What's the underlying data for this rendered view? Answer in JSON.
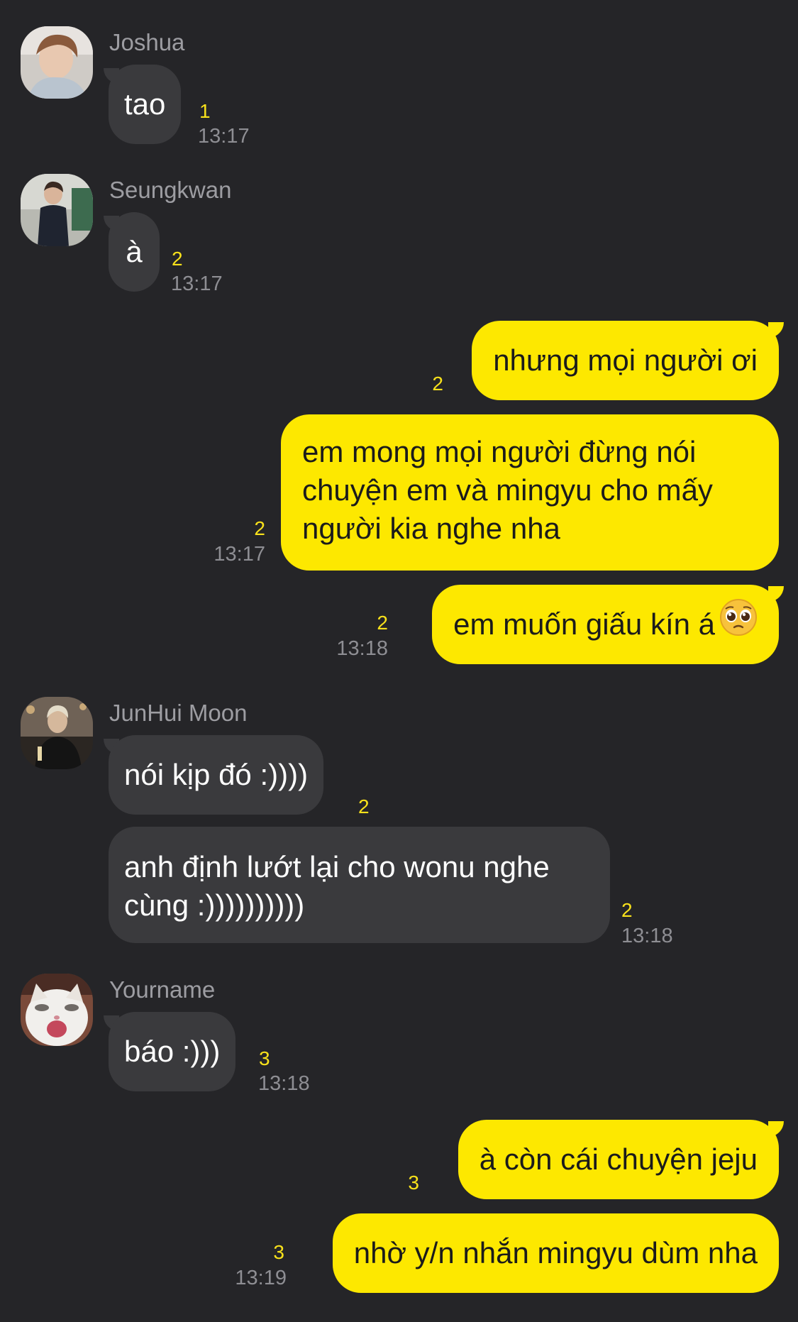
{
  "messages": [
    {
      "sender": "Joshua",
      "text": "tao",
      "unread": "1",
      "time": "13:17"
    },
    {
      "sender": "Seungkwan",
      "text": "à",
      "unread": "2",
      "time": "13:17"
    },
    {
      "sender": "me",
      "text": "nhưng mọi người ơi",
      "unread": "2"
    },
    {
      "sender": "me",
      "lines": [
        "em mong mọi người đừng nói",
        "chuyện em và mingyu cho mấy",
        "người kia nghe nha"
      ],
      "unread": "2",
      "time": "13:17"
    },
    {
      "sender": "me",
      "text": "em muốn giấu kín á",
      "emoji": "pleading-face-emoji",
      "unread": "2",
      "time": "13:18"
    },
    {
      "sender": "JunHui Moon",
      "text": "nói kịp đó :))))",
      "unread": "2"
    },
    {
      "sender": "JunHui Moon",
      "lines": [
        "anh định lướt lại cho wonu nghe",
        "cùng :))))))))))"
      ],
      "unread": "2",
      "time": "13:18"
    },
    {
      "sender": "Yourname",
      "text": "báo :)))",
      "unread": "3",
      "time": "13:18"
    },
    {
      "sender": "me",
      "text": "à còn cái chuyện jeju",
      "unread": "3"
    },
    {
      "sender": "me",
      "text": "nhờ y/n nhắn mingyu dùm nha",
      "unread": "3",
      "time": "13:19"
    }
  ],
  "colors": {
    "background": "#252528",
    "incoming_bubble": "#3a3a3d",
    "outgoing_bubble": "#fde800",
    "unread_count": "#f8e11b",
    "timestamp": "#8e8e93",
    "sender_name": "#9d9da2"
  }
}
